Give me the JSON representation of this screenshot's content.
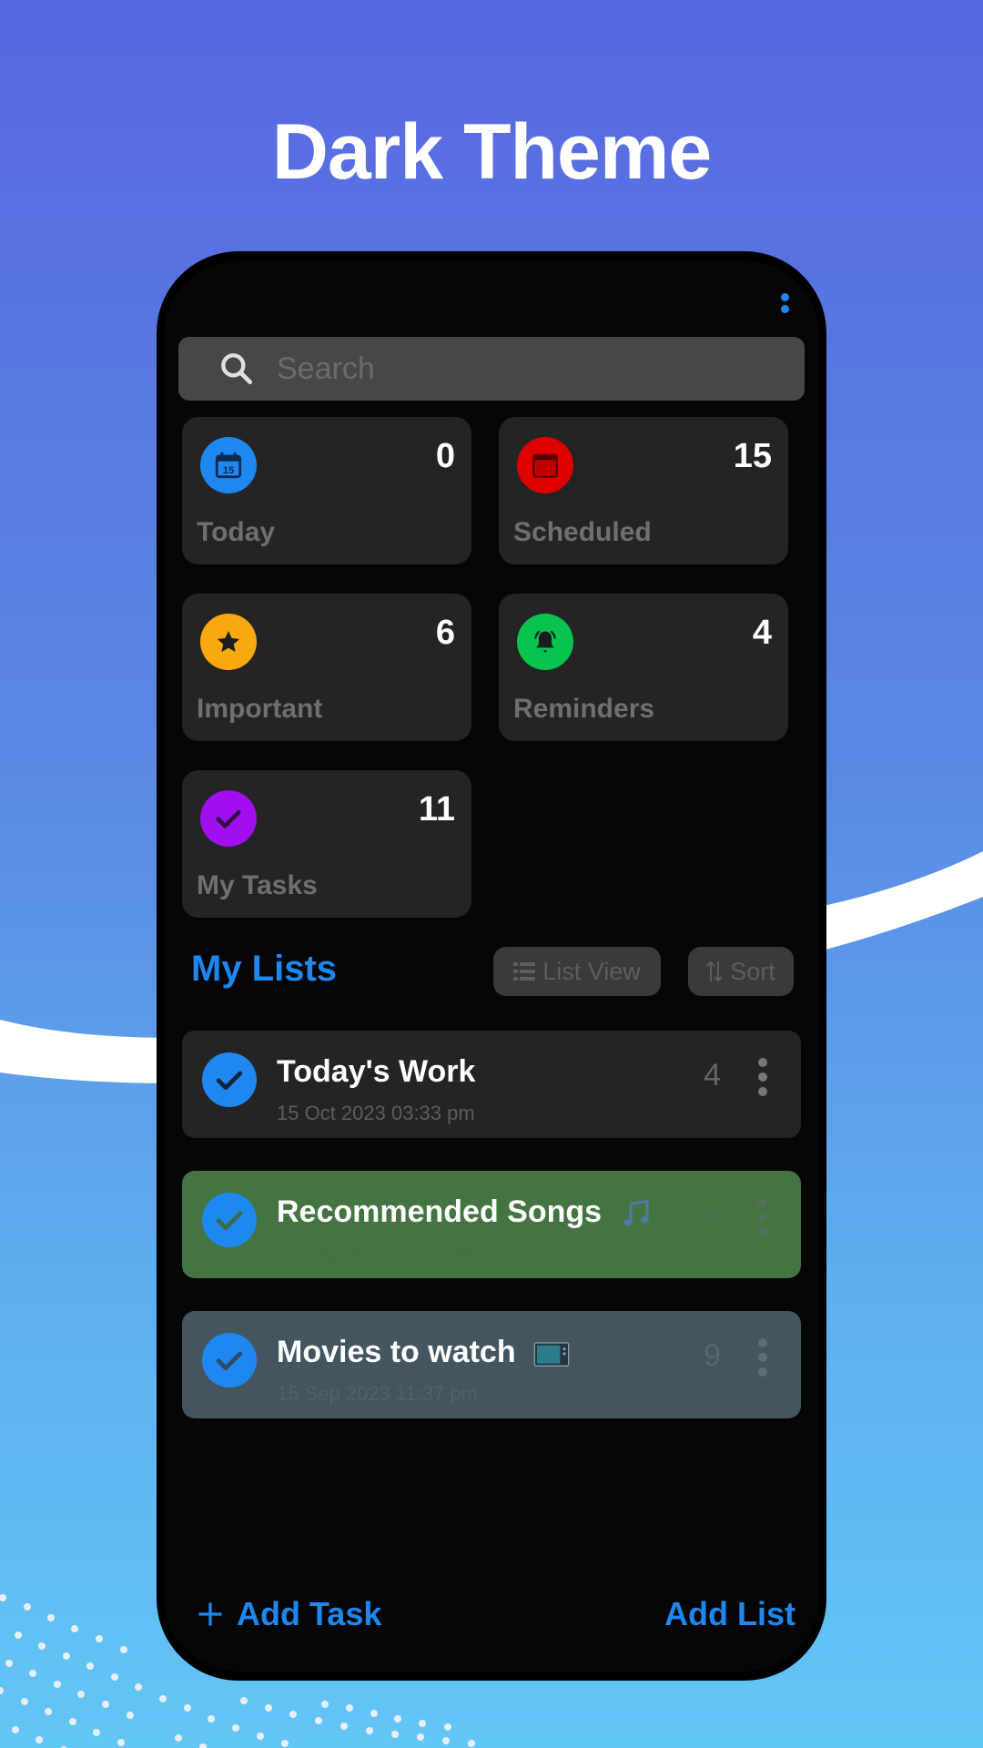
{
  "promo": {
    "title": "Dark Theme"
  },
  "colors": {
    "accent": "#1e88f0",
    "today_icon": "#1e88f0",
    "scheduled_icon": "#e00000",
    "important_icon": "#f9a80e",
    "reminders_icon": "#06c44e",
    "my_tasks_icon": "#a10ef0",
    "list_default_bg": "#242424",
    "list_songs_bg": "#437442",
    "list_movies_bg": "#435660"
  },
  "header": {
    "menu_icon": "more-vert-icon"
  },
  "search": {
    "placeholder": "Search",
    "icon": "search-icon"
  },
  "smart_lists": [
    {
      "label": "Today",
      "count": "0",
      "icon": "calendar-today-icon",
      "icon_text": "15"
    },
    {
      "label": "Scheduled",
      "count": "15",
      "icon": "calendar-icon"
    },
    {
      "label": "Important",
      "count": "6",
      "icon": "star-icon"
    },
    {
      "label": "Reminders",
      "count": "4",
      "icon": "bell-icon"
    },
    {
      "label": "My Tasks",
      "count": "11",
      "icon": "check-icon"
    }
  ],
  "my_lists": {
    "title": "My Lists",
    "list_view_label": "List View",
    "sort_label": "Sort",
    "items": [
      {
        "name": "Today's Work",
        "date": "15 Oct 2023 03:33 pm",
        "count": "4"
      },
      {
        "name": "Recommended Songs",
        "emoji": "music-note-icon",
        "date": "15 Sep 2023 11:38 pm",
        "count": "10"
      },
      {
        "name": "Movies to watch",
        "emoji": "tv-icon",
        "date": "15 Sep 2023 11:37 pm",
        "count": "9"
      }
    ]
  },
  "footer": {
    "add_task_label": "Add Task",
    "add_list_label": "Add List"
  }
}
